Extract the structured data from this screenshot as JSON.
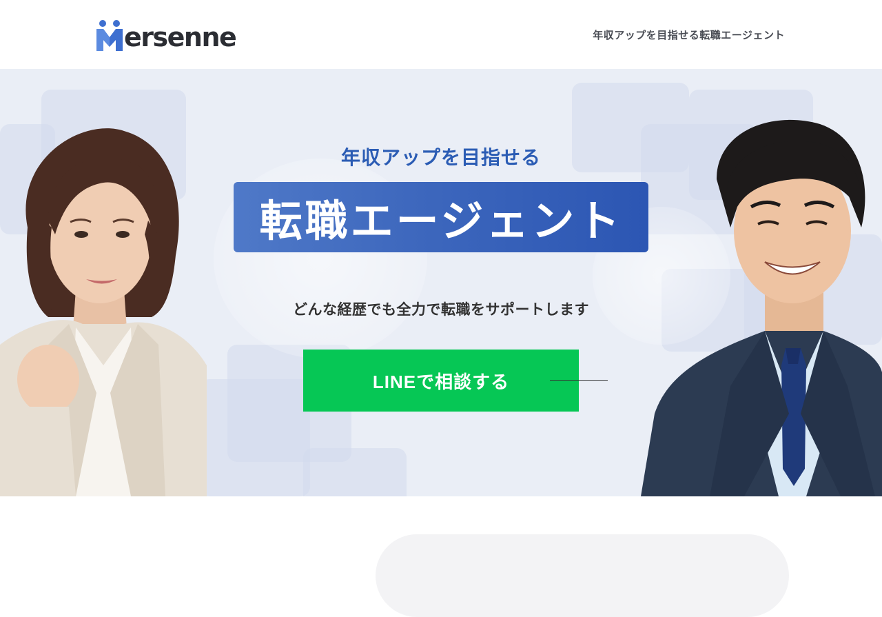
{
  "header": {
    "logo_text": "ersenne",
    "logo_icon": "mersenne-logo-mark-icon",
    "tagline": "年収アップを目指せる転職エージェント"
  },
  "hero": {
    "subtitle": "年収アップを目指せる",
    "title": "転職エージェント",
    "description": "どんな経歴でも全力で転職をサポートします",
    "cta_label": "LINEで相談する",
    "people": [
      "woman-photo",
      "man-photo"
    ]
  },
  "colors": {
    "brand_blue": "#2b5cb4",
    "line_green": "#06c755",
    "hero_bg": "#eaeef6"
  }
}
